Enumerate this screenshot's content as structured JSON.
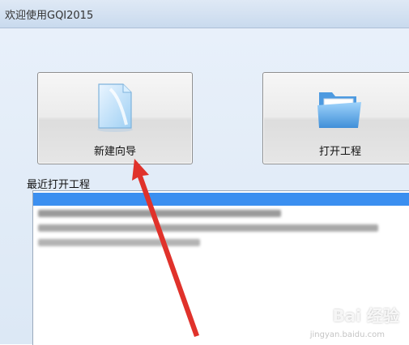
{
  "window": {
    "title": "欢迎使用GQI2015"
  },
  "buttons": [
    {
      "id": "new-wizard",
      "label": "新建向导",
      "icon": "document-icon"
    },
    {
      "id": "open-project",
      "label": "打开工程",
      "icon": "folder-icon"
    }
  ],
  "recent": {
    "label": "最近打开工程",
    "rows": [
      {
        "text": "",
        "selected": true
      },
      {
        "text": "",
        "selected": false
      },
      {
        "text": "",
        "selected": false
      },
      {
        "text": "",
        "selected": false
      }
    ]
  },
  "watermark": {
    "text": "Bai 经验",
    "subtext": "jingyan.baidu.com"
  },
  "colors": {
    "selection": "#3b8ff0",
    "arrow": "#e0322b",
    "title_bg": "#d4e2f2"
  }
}
